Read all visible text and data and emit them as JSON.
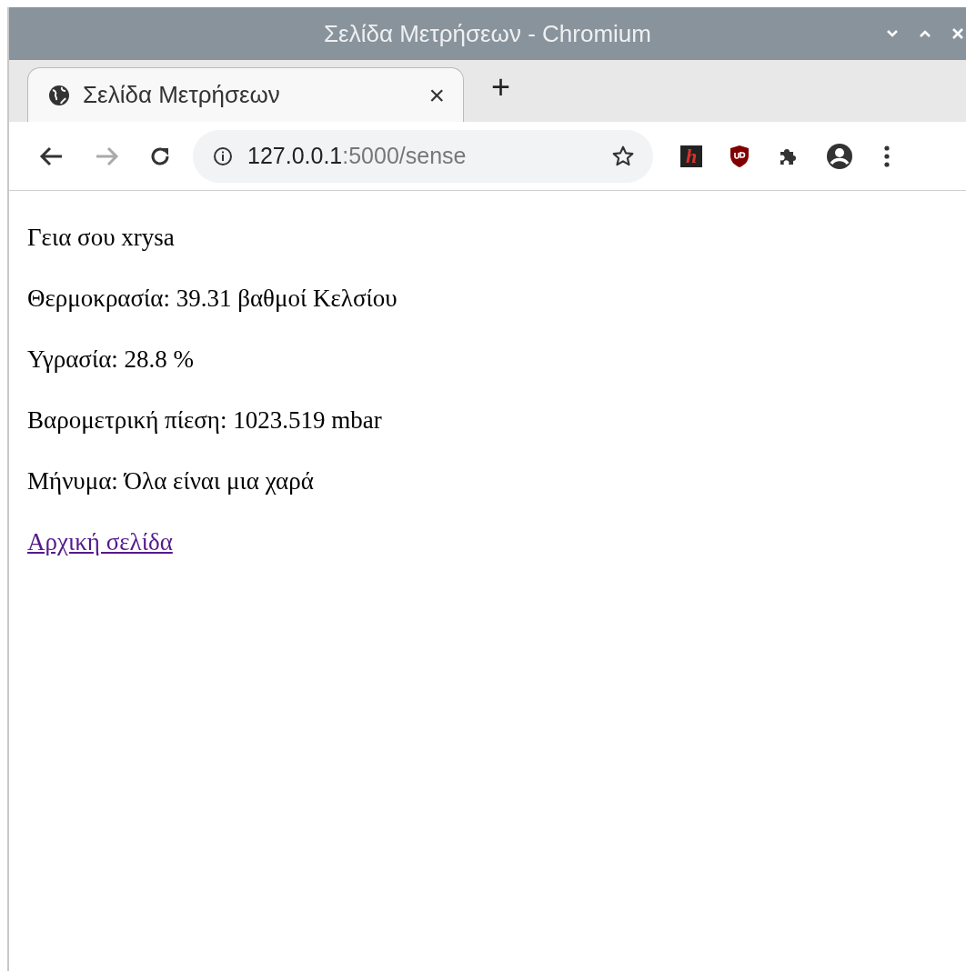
{
  "window": {
    "title": "Σελίδα Μετρήσεων - Chromium"
  },
  "tabs": [
    {
      "title": "Σελίδα Μετρήσεων",
      "selected": true,
      "close": "×"
    }
  ],
  "new_tab": "+",
  "address_bar": {
    "host": "127.0.0.1",
    "rest": ":5000/sense"
  },
  "extensions": [
    {
      "kind": "letter",
      "label": "h"
    },
    {
      "kind": "shield"
    },
    {
      "kind": "puzzle"
    }
  ],
  "content": {
    "lines": [
      "Γεια σου xrysa",
      "Θερμοκρασία: 39.31 βαθμοί Κελσίου",
      "Υγρασία: 28.8 %",
      "Βαρομετρική πίεση: 1023.519 mbar",
      "Μήνυμα: Όλα είναι μια χαρά"
    ],
    "link": {
      "text": "Αρχική σελίδα",
      "visited": true
    }
  }
}
